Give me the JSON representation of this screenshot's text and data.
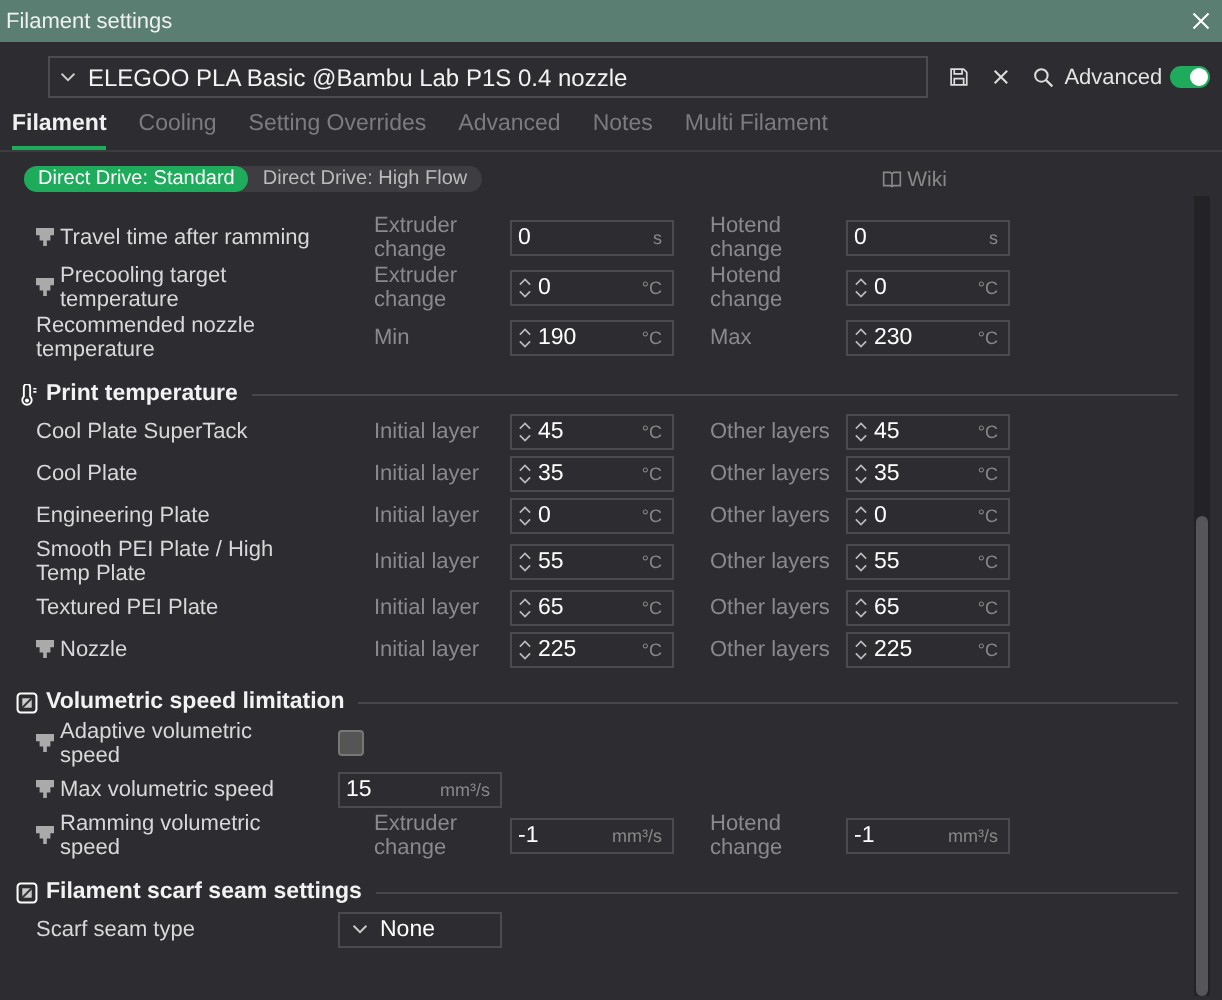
{
  "window": {
    "title": "Filament settings"
  },
  "preset": {
    "value": "ELEGOO PLA Basic @Bambu Lab P1S 0.4 nozzle"
  },
  "advanced": {
    "label": "Advanced",
    "on": true
  },
  "tabs": [
    {
      "label": "Filament",
      "selected": true
    },
    {
      "label": "Cooling",
      "selected": false
    },
    {
      "label": "Setting Overrides",
      "selected": false
    },
    {
      "label": "Advanced",
      "selected": false
    },
    {
      "label": "Notes",
      "selected": false
    },
    {
      "label": "Multi Filament",
      "selected": false
    }
  ],
  "variants": [
    {
      "label": "Direct Drive: Standard",
      "selected": true
    },
    {
      "label": "Direct Drive: High Flow",
      "selected": false
    }
  ],
  "wiki": {
    "label": "Wiki"
  },
  "sections": [
    {
      "rows": [
        {
          "kind": "pair",
          "label": "Travel time after ramming",
          "nozzle_mark": true,
          "a_label": "Extruder change",
          "a": {
            "value": "0",
            "unit": "s",
            "spinner": false
          },
          "b_label": "Hotend change",
          "b": {
            "value": "0",
            "unit": "s",
            "spinner": false
          }
        },
        {
          "kind": "pair",
          "label": "Precooling target temperature",
          "nozzle_mark": true,
          "a_label": "Extruder change",
          "a": {
            "value": "0",
            "unit": "°C",
            "spinner": true
          },
          "b_label": "Hotend change",
          "b": {
            "value": "0",
            "unit": "°C",
            "spinner": true
          }
        },
        {
          "kind": "pair",
          "label": "Recommended nozzle temperature",
          "nozzle_mark": false,
          "a_label": "Min",
          "a": {
            "value": "190",
            "unit": "°C",
            "spinner": true
          },
          "b_label": "Max",
          "b": {
            "value": "230",
            "unit": "°C",
            "spinner": true
          }
        }
      ]
    },
    {
      "title": "Print temperature",
      "kind": "temperature",
      "rows": [
        {
          "kind": "pair",
          "label": "Cool Plate SuperTack",
          "nozzle_mark": false,
          "a_label": "Initial layer",
          "a": {
            "value": "45",
            "unit": "°C",
            "spinner": true
          },
          "b_label": "Other layers",
          "b": {
            "value": "45",
            "unit": "°C",
            "spinner": true
          }
        },
        {
          "kind": "pair",
          "label": "Cool Plate",
          "nozzle_mark": false,
          "a_label": "Initial layer",
          "a": {
            "value": "35",
            "unit": "°C",
            "spinner": true
          },
          "b_label": "Other layers",
          "b": {
            "value": "35",
            "unit": "°C",
            "spinner": true
          }
        },
        {
          "kind": "pair",
          "label": "Engineering Plate",
          "nozzle_mark": false,
          "a_label": "Initial layer",
          "a": {
            "value": "0",
            "unit": "°C",
            "spinner": true
          },
          "b_label": "Other layers",
          "b": {
            "value": "0",
            "unit": "°C",
            "spinner": true
          }
        },
        {
          "kind": "pair",
          "label": "Smooth PEI Plate / High Temp Plate",
          "nozzle_mark": false,
          "a_label": "Initial layer",
          "a": {
            "value": "55",
            "unit": "°C",
            "spinner": true
          },
          "b_label": "Other layers",
          "b": {
            "value": "55",
            "unit": "°C",
            "spinner": true
          }
        },
        {
          "kind": "pair",
          "label": "Textured PEI Plate",
          "nozzle_mark": false,
          "a_label": "Initial layer",
          "a": {
            "value": "65",
            "unit": "°C",
            "spinner": true
          },
          "b_label": "Other layers",
          "b": {
            "value": "65",
            "unit": "°C",
            "spinner": true
          }
        },
        {
          "kind": "pair",
          "label": "Nozzle",
          "nozzle_mark": true,
          "a_label": "Initial layer",
          "a": {
            "value": "225",
            "unit": "°C",
            "spinner": true
          },
          "b_label": "Other layers",
          "b": {
            "value": "225",
            "unit": "°C",
            "spinner": true
          }
        }
      ]
    },
    {
      "title": "Volumetric speed limitation",
      "kind": "speed",
      "rows": [
        {
          "kind": "checkbox",
          "label": "Adaptive volumetric speed",
          "nozzle_mark": true,
          "checked": false
        },
        {
          "kind": "single",
          "label": "Max volumetric speed",
          "nozzle_mark": true,
          "a": {
            "value": "15",
            "unit": "mm³/s",
            "spinner": false
          }
        },
        {
          "kind": "pair",
          "label": "Ramming volumetric speed",
          "nozzle_mark": true,
          "a_label": "Extruder change",
          "a": {
            "value": "-1",
            "unit": "mm³/s",
            "spinner": false
          },
          "b_label": "Hotend change",
          "b": {
            "value": "-1",
            "unit": "mm³/s",
            "spinner": false
          }
        }
      ]
    },
    {
      "title": "Filament scarf seam settings",
      "kind": "speed",
      "rows": [
        {
          "kind": "dropdown",
          "label": "Scarf seam type",
          "nozzle_mark": false,
          "value": "None"
        }
      ]
    }
  ]
}
